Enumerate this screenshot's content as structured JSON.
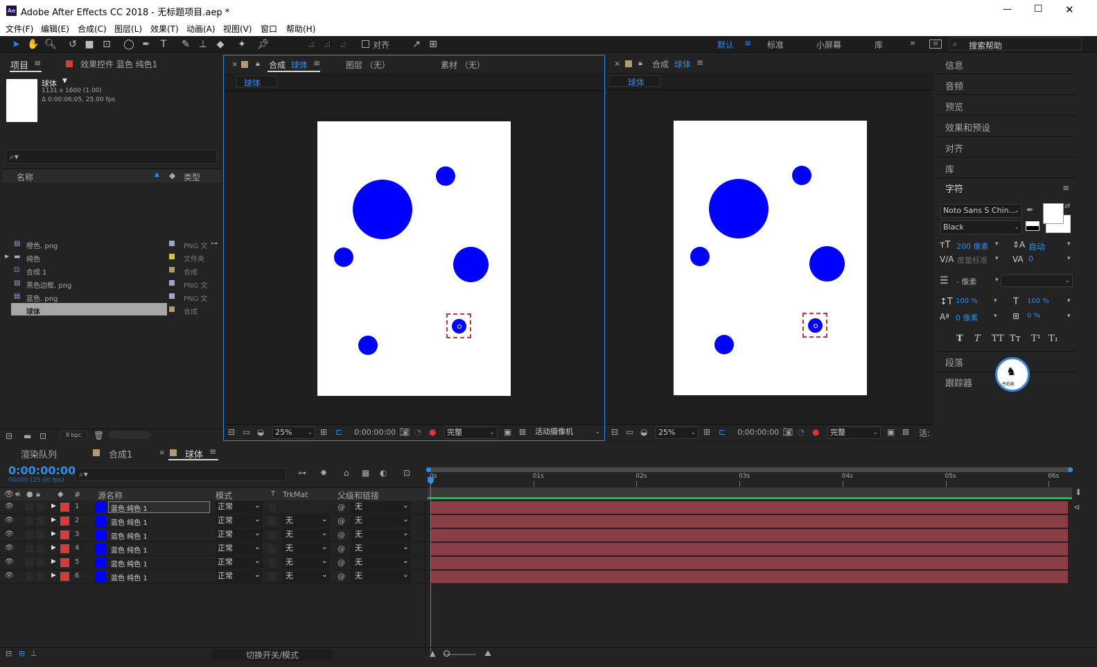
{
  "window": {
    "title": "Adobe After Effects CC 2018 - 无标题项目.aep *",
    "app_badge": "Ae",
    "controls": {
      "minimize": "—",
      "maximize": "☐",
      "close": "✕"
    }
  },
  "menu": [
    "文件(F)",
    "编辑(E)",
    "合成(C)",
    "图层(L)",
    "效果(T)",
    "动画(A)",
    "视图(V)",
    "窗口",
    "帮助(H)"
  ],
  "toolbar": {
    "align_label": "对齐",
    "workspaces": [
      "默认",
      "标准",
      "小屏幕",
      "库"
    ],
    "active_workspace": "默认",
    "search_placeholder": "搜索帮助"
  },
  "project_panel": {
    "tab_label": "项目",
    "effects_tab_label": "效果控件 蓝色 纯色1",
    "selected_name": "球体",
    "selected_info_1": "1131 x 1600 (1.00)",
    "selected_info_2": "Δ 0:00:06:05, 25.00 fps",
    "col_name": "名称",
    "col_type": "类型",
    "items": [
      {
        "name": "橙色. png",
        "type": "PNG 文",
        "tag": "#a7a0c8",
        "icon": "image-icon"
      },
      {
        "name": "纯色",
        "type": "文件夹",
        "tag": "#d7c53c",
        "icon": "folder-icon"
      },
      {
        "name": "合成 1",
        "type": "合成",
        "tag": "#b49a73",
        "icon": "composition-icon"
      },
      {
        "name": "黑色边框. png",
        "type": "PNG 文",
        "tag": "#a7a0c8",
        "icon": "image-icon"
      },
      {
        "name": "蓝色. png",
        "type": "PNG 文",
        "tag": "#a7a0c8",
        "icon": "image-icon"
      },
      {
        "name": "球体",
        "type": "合成",
        "tag": "#b49a73",
        "icon": "composition-icon"
      }
    ],
    "bpc_label": "8 bpc"
  },
  "viewer_left": {
    "tab_prefix": "合成",
    "tab_name": "球体",
    "layer_tab": "图层 （无）",
    "footage_tab": "素材 （无）",
    "subtab": "球体",
    "zoom": "25%",
    "timecode": "0:00:00:00",
    "quality": "完整",
    "camera": "活动摄像机"
  },
  "viewer_right": {
    "tab_prefix": "合成",
    "tab_name": "球体",
    "subtab": "球体",
    "zoom": "25%",
    "timecode": "0:00:00:00",
    "quality": "完整",
    "camera": "活:"
  },
  "right_panel": {
    "items": [
      "信息",
      "音频",
      "预览",
      "效果和预设",
      "对齐",
      "库"
    ],
    "character_title": "字符",
    "font_family": "Noto Sans S Chin...",
    "font_style": "Black",
    "font_size": "200 像素",
    "leading": "自动",
    "kerning": "度量标准",
    "tracking": "0",
    "stroke_width": "- 像素",
    "vert_scale": "100 %",
    "horiz_scale": "100 %",
    "baseline": "0 像素",
    "tsume": "0 %",
    "style_buttons": [
      "T",
      "T",
      "TT",
      "Tт",
      "T¹",
      "T₁"
    ],
    "paragraph": "段落",
    "tracker": "跟踪器",
    "logo_text": "竹石影"
  },
  "timeline": {
    "tabs": [
      "渲染队列",
      "合成1",
      "球体"
    ],
    "timecode": "0:00:00:00",
    "frame_info": "00000 (25.00 fps)",
    "col_source": "源名称",
    "col_mode": "模式",
    "col_t": "T",
    "col_trkmat": "TrkMat",
    "col_parent": "父级和链接",
    "ruler": [
      "0s",
      "01s",
      "02s",
      "03s",
      "04s",
      "05s",
      "06s"
    ],
    "layers": [
      {
        "num": "1",
        "name": "蓝色 纯色 1",
        "mode": "正常",
        "trkmat": "",
        "parent": "无"
      },
      {
        "num": "2",
        "name": "蓝色 纯色 1",
        "mode": "正常",
        "trkmat": "无",
        "parent": "无"
      },
      {
        "num": "3",
        "name": "蓝色 纯色 1",
        "mode": "正常",
        "trkmat": "无",
        "parent": "无"
      },
      {
        "num": "4",
        "name": "蓝色 纯色 1",
        "mode": "正常",
        "trkmat": "无",
        "parent": "无"
      },
      {
        "num": "5",
        "name": "蓝色 纯色 1",
        "mode": "正常",
        "trkmat": "无",
        "parent": "无"
      },
      {
        "num": "6",
        "name": "蓝色 纯色 1",
        "mode": "正常",
        "trkmat": "无",
        "parent": "无"
      }
    ],
    "toggle_label": "切换开关/模式"
  },
  "colors": {
    "accent": "#2d8ceb",
    "layer_bar": "#8b3e45",
    "label_red": "#d43b3b",
    "solid_blue": "#0000ff"
  }
}
